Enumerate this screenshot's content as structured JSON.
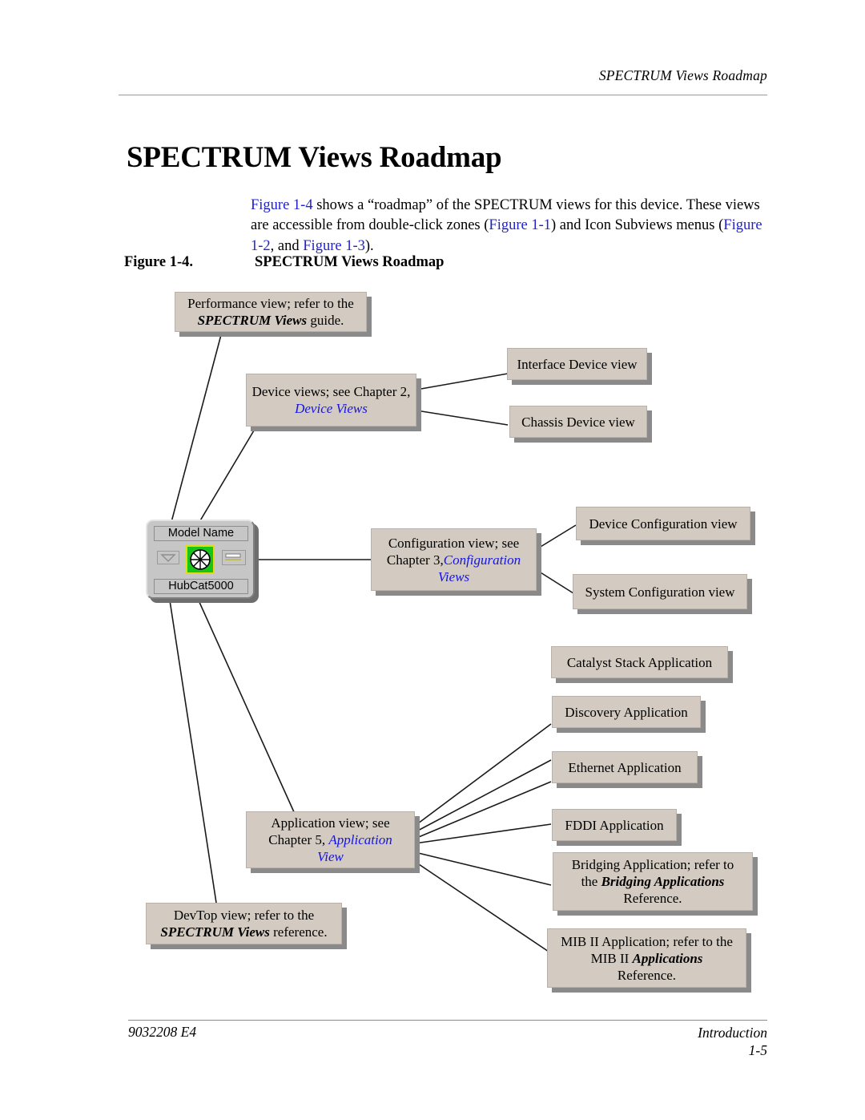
{
  "header": {
    "running_head": "SPECTRUM Views Roadmap"
  },
  "title": "SPECTRUM Views Roadmap",
  "intro": {
    "seg1": "Figure 1-4",
    "seg2": " shows a “roadmap” of the SPECTRUM views for this device. These views are accessible from double-click zones (",
    "seg3": "Figure 1-1",
    "seg4": ") and Icon Subviews menus (",
    "seg5": "Figure 1-2",
    "seg6": ", and ",
    "seg7": "Figure 1-3",
    "seg8": ")."
  },
  "figure": {
    "number": "Figure 1-4.",
    "caption": "SPECTRUM Views Roadmap"
  },
  "device_icon": {
    "name_label": "Model Name",
    "model_label": "HubCat5000",
    "status_color": "#17c417",
    "status_border_color": "#dede12"
  },
  "nodes": {
    "performance": {
      "line1": "Performance view; refer to the",
      "bold": "SPECTRUM Views",
      "tail": " guide."
    },
    "device_views": {
      "line1": "Device views; see Chapter 2,",
      "italic_blue": "Device Views"
    },
    "interface_device_view": {
      "label": "Interface Device view"
    },
    "chassis_device_view": {
      "label": "Chassis Device view"
    },
    "configuration": {
      "line1": "Configuration view; see",
      "line2_prefix": "Chapter 3,",
      "italic_blue": "Configuration",
      "italic_blue2": "Views"
    },
    "device_configuration_view": {
      "label": "Device Configuration view"
    },
    "system_configuration_view": {
      "label": "System Configuration view"
    },
    "application": {
      "line1": "Application view; see",
      "line2_prefix": "Chapter 5, ",
      "italic_blue": "Application",
      "italic_blue2": "View"
    },
    "catalyst_stack_application": {
      "label": "Catalyst Stack Application"
    },
    "discovery_application": {
      "label": "Discovery Application"
    },
    "ethernet_application": {
      "label": "Ethernet Application"
    },
    "fddi_application": {
      "label": "FDDI Application"
    },
    "bridging_application": {
      "line1": "Bridging Application; refer to",
      "line2_prefix": "the ",
      "bold": "Bridging Applications",
      "line3": "Reference."
    },
    "mib2_application": {
      "line1": "MIB II Application; refer to the",
      "line2_prefix": "MIB II ",
      "bold": "Applications",
      "line3": "Reference."
    },
    "devtop": {
      "bold": "SPECTRUM Views",
      "line1": "DevTop view; refer to the",
      "tail": " reference."
    }
  },
  "footer": {
    "left": "9032208 E4",
    "right_line1": "Introduction",
    "right_line2": "1-5"
  },
  "colors": {
    "node_fill": "#d3cbc1",
    "node_shadow": "#8a8a8a",
    "link_blue": "#1414e6",
    "xref_blue": "#2222cc"
  }
}
